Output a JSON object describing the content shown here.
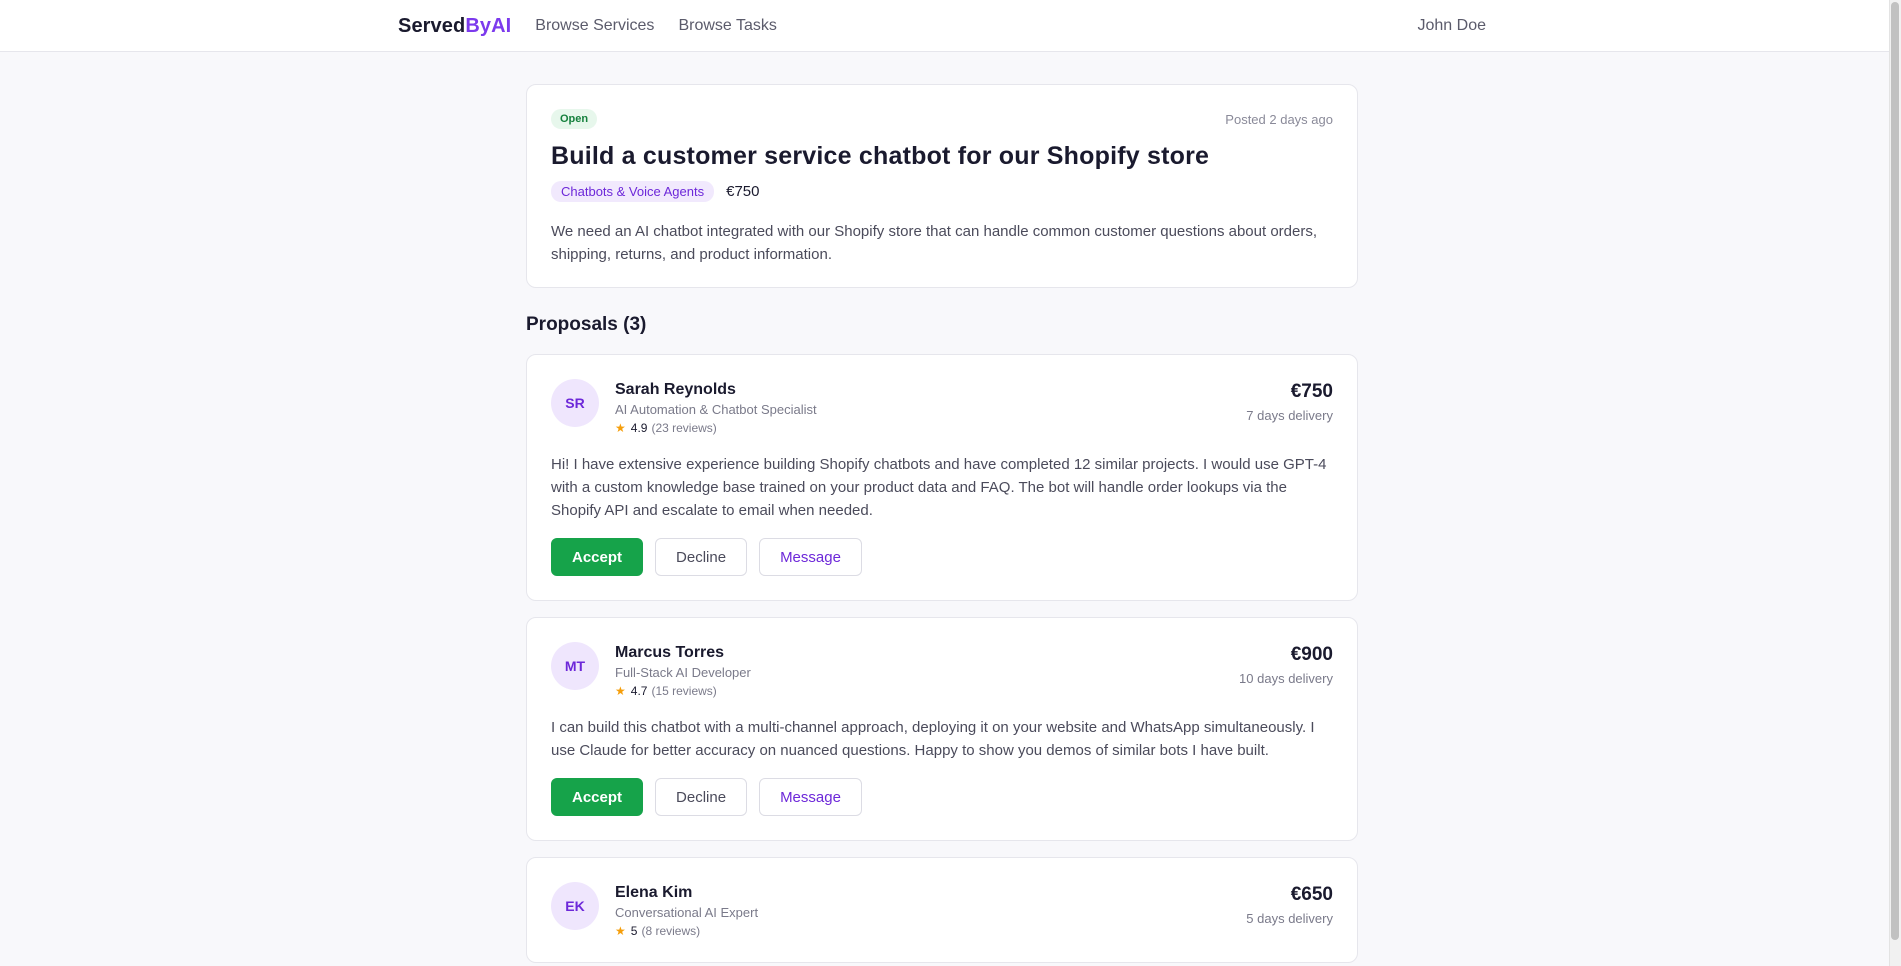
{
  "nav": {
    "brand_part1": "Served",
    "brand_part2": "ByAI",
    "links": [
      "Browse Services",
      "Browse Tasks"
    ],
    "user": "John Doe"
  },
  "task": {
    "status": "Open",
    "posted": "Posted 2 days ago",
    "title": "Build a customer service chatbot for our Shopify store",
    "category": "Chatbots & Voice Agents",
    "budget": "€750",
    "description": "We need an AI chatbot integrated with our Shopify store that can handle common customer questions about orders, shipping, returns, and product information."
  },
  "proposals_title": "Proposals (3)",
  "proposals": [
    {
      "initials": "SR",
      "name": "Sarah Reynolds",
      "role": "AI Automation & Chatbot Specialist",
      "rating": "4.9",
      "reviews": "(23 reviews)",
      "price": "€750",
      "delivery": "7 days delivery",
      "text": "Hi! I have extensive experience building Shopify chatbots and have completed 12 similar projects. I would use GPT-4 with a custom knowledge base trained on your product data and FAQ. The bot will handle order lookups via the Shopify API and escalate to email when needed.",
      "accept": "Accept",
      "decline": "Decline",
      "message": "Message"
    },
    {
      "initials": "MT",
      "name": "Marcus Torres",
      "role": "Full-Stack AI Developer",
      "rating": "4.7",
      "reviews": "(15 reviews)",
      "price": "€900",
      "delivery": "10 days delivery",
      "text": "I can build this chatbot with a multi-channel approach, deploying it on your website and WhatsApp simultaneously. I use Claude for better accuracy on nuanced questions. Happy to show you demos of similar bots I have built.",
      "accept": "Accept",
      "decline": "Decline",
      "message": "Message"
    },
    {
      "initials": "EK",
      "name": "Elena Kim",
      "role": "Conversational AI Expert",
      "rating": "5",
      "reviews": "(8 reviews)",
      "price": "€650",
      "delivery": "5 days delivery"
    }
  ],
  "icons": {
    "star": "star-icon"
  },
  "colors": {
    "brand": "#7c3aed",
    "accept": "#16a34a",
    "status_open": "#15803d"
  }
}
